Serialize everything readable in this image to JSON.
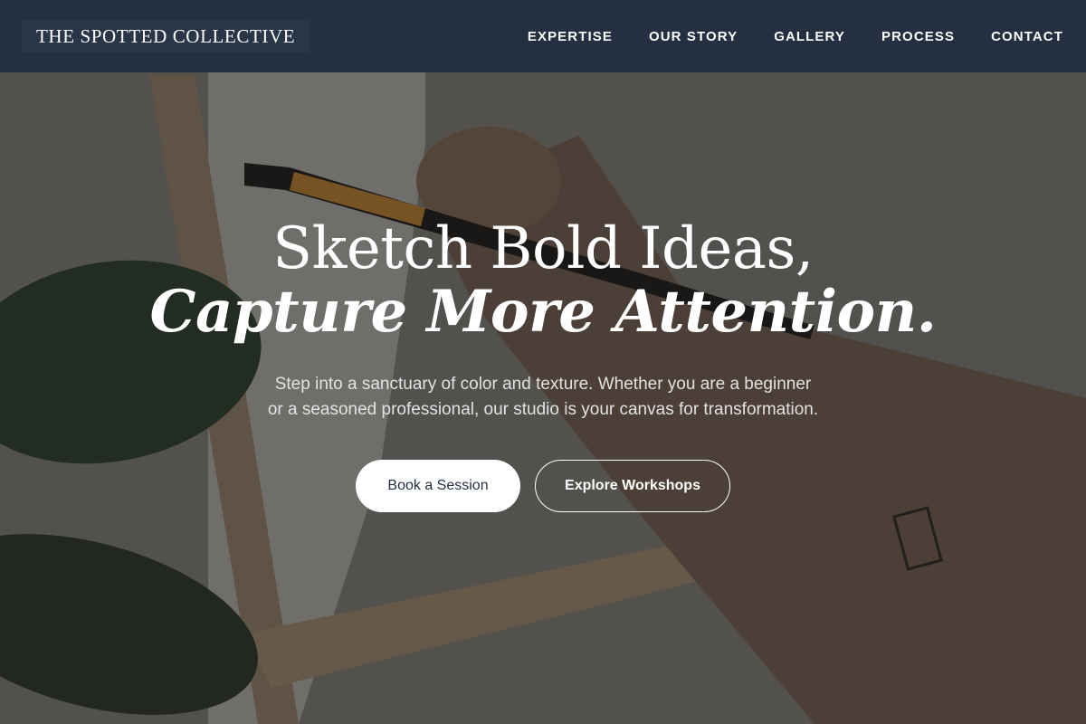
{
  "brand": {
    "name": "THE SPOTTED COLLECTIVE"
  },
  "nav": {
    "items": [
      "EXPERTISE",
      "OUR STORY",
      "GALLERY",
      "PROCESS",
      "CONTACT"
    ]
  },
  "hero": {
    "headline_line1": "Sketch Bold Ideas,",
    "headline_line2": "Capture More Attention.",
    "subtext_line1": "Step into a sanctuary of color and texture. Whether you are a beginner",
    "subtext_line2": "or a seasoned professional, our studio is your canvas for transformation.",
    "primary_cta": "Book a Session",
    "secondary_cta": "Explore Workshops"
  },
  "colors": {
    "header_bg": "#243041",
    "button_text": "#243041",
    "text_primary": "#ffffff"
  }
}
